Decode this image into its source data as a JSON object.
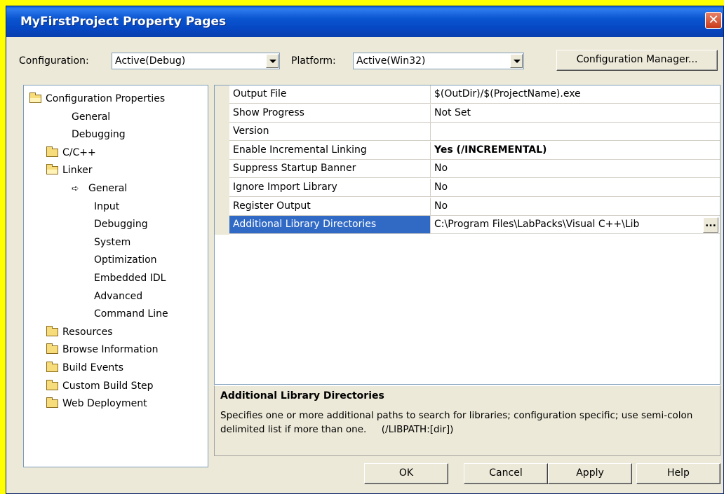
{
  "window": {
    "title": "MyFirstProject Property Pages",
    "close_glyph": "✕"
  },
  "config": {
    "configuration_label": "Configuration:",
    "configuration_value": "Active(Debug)",
    "platform_label": "Platform:",
    "platform_value": "Active(Win32)",
    "manager_button": "Configuration Manager..."
  },
  "tree": {
    "items": [
      {
        "label": "Configuration Properties",
        "icon": "folder-open-icon"
      },
      {
        "label": "General"
      },
      {
        "label": "Debugging"
      },
      {
        "label": "C/C++",
        "icon": "folder-icon"
      },
      {
        "label": "Linker",
        "icon": "folder-open-icon"
      },
      {
        "label": "General",
        "icon": "arrow-icon",
        "glyph": "➪"
      },
      {
        "label": "Input"
      },
      {
        "label": "Debugging"
      },
      {
        "label": "System"
      },
      {
        "label": "Optimization"
      },
      {
        "label": "Embedded IDL"
      },
      {
        "label": "Advanced"
      },
      {
        "label": "Command Line"
      },
      {
        "label": "Resources",
        "icon": "folder-icon"
      },
      {
        "label": "Browse Information",
        "icon": "folder-icon"
      },
      {
        "label": "Build Events",
        "icon": "folder-icon"
      },
      {
        "label": "Custom Build Step",
        "icon": "folder-icon"
      },
      {
        "label": "Web Deployment",
        "icon": "folder-icon"
      }
    ]
  },
  "grid": {
    "rows": [
      {
        "name": "Output File",
        "value": "$(OutDir)/$(ProjectName).exe"
      },
      {
        "name": "Show Progress",
        "value": "Not Set"
      },
      {
        "name": "Version",
        "value": ""
      },
      {
        "name": "Enable Incremental Linking",
        "value": "Yes (/INCREMENTAL)",
        "bold": true
      },
      {
        "name": "Suppress Startup Banner",
        "value": "No"
      },
      {
        "name": "Ignore Import Library",
        "value": "No"
      },
      {
        "name": "Register Output",
        "value": "No"
      },
      {
        "name": "Additional Library Directories",
        "value": "C:\\Program Files\\LabPacks\\Visual C++\\Lib",
        "selected": true
      }
    ],
    "ellipsis_label": "..."
  },
  "description": {
    "title": "Additional Library Directories",
    "text": "Specifies one or more additional paths to search for libraries; configuration specific; use semi-colon delimited list if more than one.     (/LIBPATH:[dir])"
  },
  "buttons": {
    "ok": "OK",
    "cancel": "Cancel",
    "apply": "Apply",
    "help": "Help"
  }
}
